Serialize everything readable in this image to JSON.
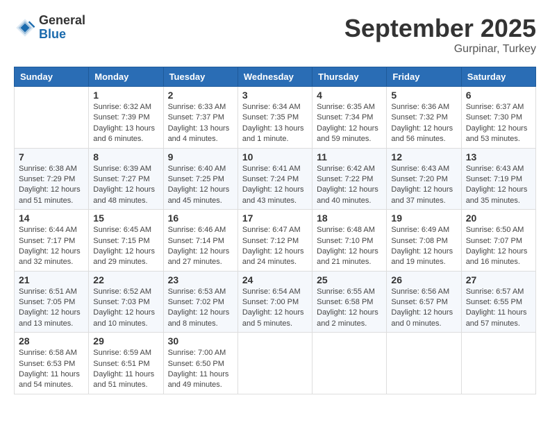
{
  "header": {
    "logo_general": "General",
    "logo_blue": "Blue",
    "month_title": "September 2025",
    "location": "Gurpinar, Turkey"
  },
  "weekdays": [
    "Sunday",
    "Monday",
    "Tuesday",
    "Wednesday",
    "Thursday",
    "Friday",
    "Saturday"
  ],
  "weeks": [
    [
      {
        "day": "",
        "info": ""
      },
      {
        "day": "1",
        "info": "Sunrise: 6:32 AM\nSunset: 7:39 PM\nDaylight: 13 hours\nand 6 minutes."
      },
      {
        "day": "2",
        "info": "Sunrise: 6:33 AM\nSunset: 7:37 PM\nDaylight: 13 hours\nand 4 minutes."
      },
      {
        "day": "3",
        "info": "Sunrise: 6:34 AM\nSunset: 7:35 PM\nDaylight: 13 hours\nand 1 minute."
      },
      {
        "day": "4",
        "info": "Sunrise: 6:35 AM\nSunset: 7:34 PM\nDaylight: 12 hours\nand 59 minutes."
      },
      {
        "day": "5",
        "info": "Sunrise: 6:36 AM\nSunset: 7:32 PM\nDaylight: 12 hours\nand 56 minutes."
      },
      {
        "day": "6",
        "info": "Sunrise: 6:37 AM\nSunset: 7:30 PM\nDaylight: 12 hours\nand 53 minutes."
      }
    ],
    [
      {
        "day": "7",
        "info": "Sunrise: 6:38 AM\nSunset: 7:29 PM\nDaylight: 12 hours\nand 51 minutes."
      },
      {
        "day": "8",
        "info": "Sunrise: 6:39 AM\nSunset: 7:27 PM\nDaylight: 12 hours\nand 48 minutes."
      },
      {
        "day": "9",
        "info": "Sunrise: 6:40 AM\nSunset: 7:25 PM\nDaylight: 12 hours\nand 45 minutes."
      },
      {
        "day": "10",
        "info": "Sunrise: 6:41 AM\nSunset: 7:24 PM\nDaylight: 12 hours\nand 43 minutes."
      },
      {
        "day": "11",
        "info": "Sunrise: 6:42 AM\nSunset: 7:22 PM\nDaylight: 12 hours\nand 40 minutes."
      },
      {
        "day": "12",
        "info": "Sunrise: 6:43 AM\nSunset: 7:20 PM\nDaylight: 12 hours\nand 37 minutes."
      },
      {
        "day": "13",
        "info": "Sunrise: 6:43 AM\nSunset: 7:19 PM\nDaylight: 12 hours\nand 35 minutes."
      }
    ],
    [
      {
        "day": "14",
        "info": "Sunrise: 6:44 AM\nSunset: 7:17 PM\nDaylight: 12 hours\nand 32 minutes."
      },
      {
        "day": "15",
        "info": "Sunrise: 6:45 AM\nSunset: 7:15 PM\nDaylight: 12 hours\nand 29 minutes."
      },
      {
        "day": "16",
        "info": "Sunrise: 6:46 AM\nSunset: 7:14 PM\nDaylight: 12 hours\nand 27 minutes."
      },
      {
        "day": "17",
        "info": "Sunrise: 6:47 AM\nSunset: 7:12 PM\nDaylight: 12 hours\nand 24 minutes."
      },
      {
        "day": "18",
        "info": "Sunrise: 6:48 AM\nSunset: 7:10 PM\nDaylight: 12 hours\nand 21 minutes."
      },
      {
        "day": "19",
        "info": "Sunrise: 6:49 AM\nSunset: 7:08 PM\nDaylight: 12 hours\nand 19 minutes."
      },
      {
        "day": "20",
        "info": "Sunrise: 6:50 AM\nSunset: 7:07 PM\nDaylight: 12 hours\nand 16 minutes."
      }
    ],
    [
      {
        "day": "21",
        "info": "Sunrise: 6:51 AM\nSunset: 7:05 PM\nDaylight: 12 hours\nand 13 minutes."
      },
      {
        "day": "22",
        "info": "Sunrise: 6:52 AM\nSunset: 7:03 PM\nDaylight: 12 hours\nand 10 minutes."
      },
      {
        "day": "23",
        "info": "Sunrise: 6:53 AM\nSunset: 7:02 PM\nDaylight: 12 hours\nand 8 minutes."
      },
      {
        "day": "24",
        "info": "Sunrise: 6:54 AM\nSunset: 7:00 PM\nDaylight: 12 hours\nand 5 minutes."
      },
      {
        "day": "25",
        "info": "Sunrise: 6:55 AM\nSunset: 6:58 PM\nDaylight: 12 hours\nand 2 minutes."
      },
      {
        "day": "26",
        "info": "Sunrise: 6:56 AM\nSunset: 6:57 PM\nDaylight: 12 hours\nand 0 minutes."
      },
      {
        "day": "27",
        "info": "Sunrise: 6:57 AM\nSunset: 6:55 PM\nDaylight: 11 hours\nand 57 minutes."
      }
    ],
    [
      {
        "day": "28",
        "info": "Sunrise: 6:58 AM\nSunset: 6:53 PM\nDaylight: 11 hours\nand 54 minutes."
      },
      {
        "day": "29",
        "info": "Sunrise: 6:59 AM\nSunset: 6:51 PM\nDaylight: 11 hours\nand 51 minutes."
      },
      {
        "day": "30",
        "info": "Sunrise: 7:00 AM\nSunset: 6:50 PM\nDaylight: 11 hours\nand 49 minutes."
      },
      {
        "day": "",
        "info": ""
      },
      {
        "day": "",
        "info": ""
      },
      {
        "day": "",
        "info": ""
      },
      {
        "day": "",
        "info": ""
      }
    ]
  ]
}
